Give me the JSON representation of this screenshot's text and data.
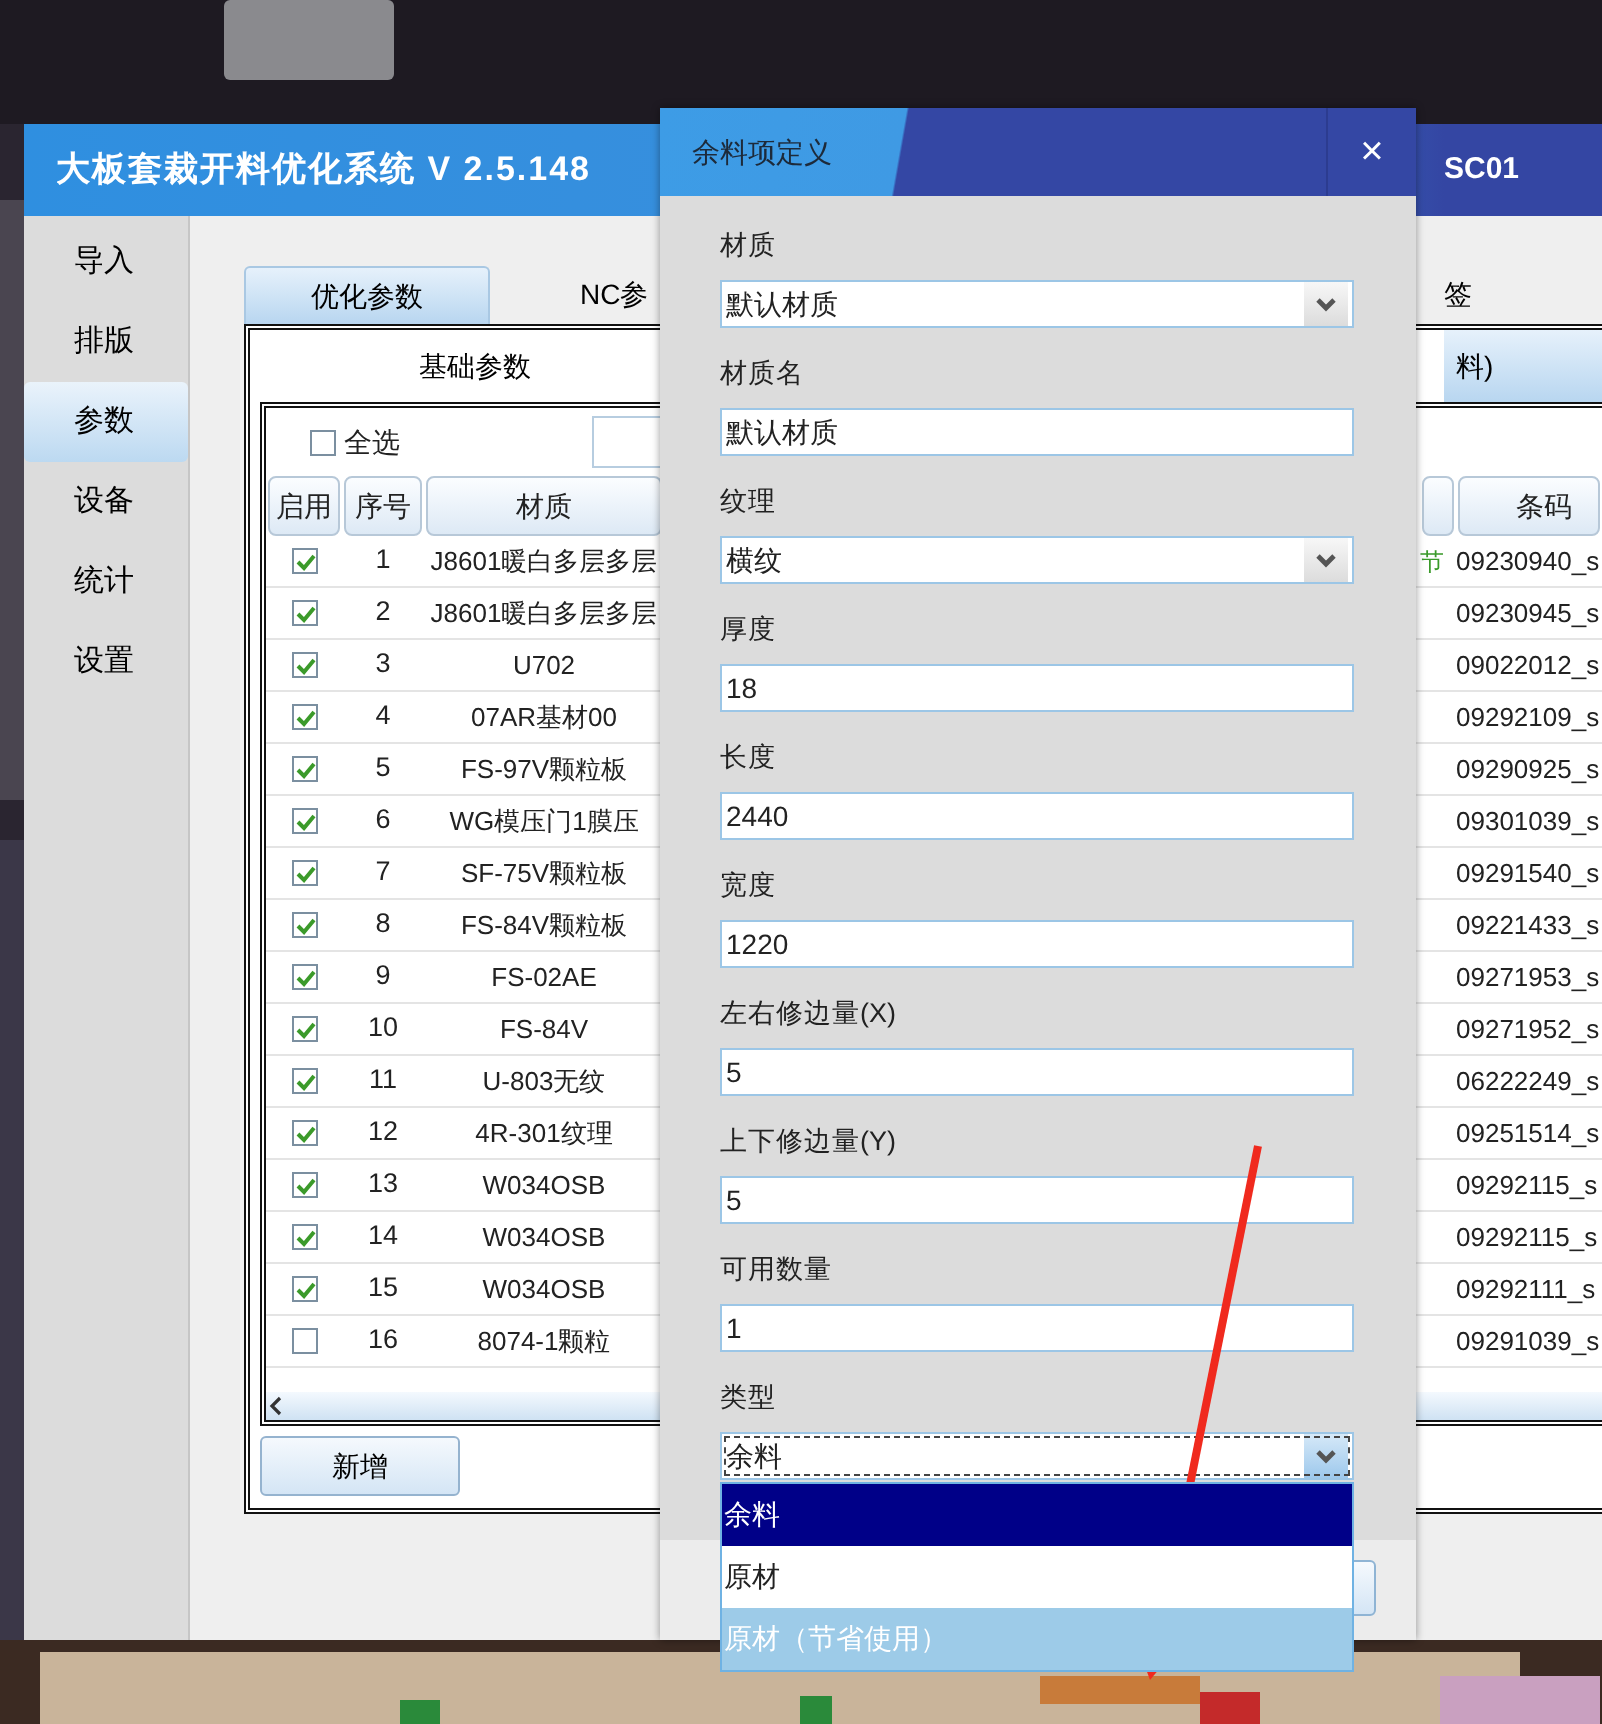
{
  "main_window": {
    "title": "大板套裁开料优化系统 V 2.5.148",
    "badge": "SC01"
  },
  "sidebar": {
    "items": [
      {
        "label": "导入",
        "selected": false
      },
      {
        "label": "排版",
        "selected": false
      },
      {
        "label": "参数",
        "selected": true
      },
      {
        "label": "设备",
        "selected": false
      },
      {
        "label": "统计",
        "selected": false
      },
      {
        "label": "设置",
        "selected": false
      }
    ]
  },
  "tabs": [
    {
      "label": "优化参数",
      "selected": true
    },
    {
      "label": "NC参",
      "selected": false
    },
    {
      "label": "签",
      "selected": false
    }
  ],
  "subtabs": [
    {
      "label": "基础参数",
      "selected": false
    },
    {
      "label": "料)",
      "selected": true
    }
  ],
  "select_all": {
    "label": "全选",
    "checked": false
  },
  "table": {
    "columns": [
      {
        "label": "启用"
      },
      {
        "label": "序号"
      },
      {
        "label": "材质"
      },
      {
        "label": "条码"
      }
    ],
    "rows": [
      {
        "enabled": true,
        "number": "1",
        "material": "J8601暖白多层多层",
        "column_4": "节",
        "barcode": "09230940_s"
      },
      {
        "enabled": true,
        "number": "2",
        "material": "J8601暖白多层多层",
        "barcode": "09230945_s"
      },
      {
        "enabled": true,
        "number": "3",
        "material": "U702",
        "barcode": "09022012_s"
      },
      {
        "enabled": true,
        "number": "4",
        "material": "07AR基材00",
        "barcode": "09292109_s"
      },
      {
        "enabled": true,
        "number": "5",
        "material": "FS-97V颗粒板",
        "barcode": "09290925_s"
      },
      {
        "enabled": true,
        "number": "6",
        "material": "WG模压门1膜压",
        "barcode": "09301039_s"
      },
      {
        "enabled": true,
        "number": "7",
        "material": "SF-75V颗粒板",
        "barcode": "09291540_s"
      },
      {
        "enabled": true,
        "number": "8",
        "material": "FS-84V颗粒板",
        "barcode": "09221433_s"
      },
      {
        "enabled": true,
        "number": "9",
        "material": "FS-02AE",
        "barcode": "09271953_s"
      },
      {
        "enabled": true,
        "number": "10",
        "material": "FS-84V",
        "barcode": "09271952_s"
      },
      {
        "enabled": true,
        "number": "11",
        "material": "U-803无纹",
        "barcode": "06222249_s"
      },
      {
        "enabled": true,
        "number": "12",
        "material": "4R-301纹理",
        "barcode": "09251514_s"
      },
      {
        "enabled": true,
        "number": "13",
        "material": "W034OSB",
        "barcode": "09292115_s"
      },
      {
        "enabled": true,
        "number": "14",
        "material": "W034OSB",
        "barcode": "09292115_s"
      },
      {
        "enabled": true,
        "number": "15",
        "material": "W034OSB",
        "barcode": "09292111_s"
      },
      {
        "enabled": false,
        "number": "16",
        "material": "8074-1颗粒",
        "barcode": "09291039_s"
      }
    ]
  },
  "add_button": "新增",
  "dialog": {
    "title": "余料项定义",
    "close": "×",
    "fields": [
      {
        "label": "材质",
        "kind": "select",
        "value": "默认材质"
      },
      {
        "label": "材质名",
        "kind": "text",
        "value": "默认材质"
      },
      {
        "label": "纹理",
        "kind": "select",
        "value": "横纹"
      },
      {
        "label": "厚度",
        "kind": "text",
        "value": "18"
      },
      {
        "label": "长度",
        "kind": "text",
        "value": "2440"
      },
      {
        "label": "宽度",
        "kind": "text",
        "value": "1220"
      },
      {
        "label": "左右修边量(X)",
        "kind": "text",
        "value": "5"
      },
      {
        "label": "上下修边量(Y)",
        "kind": "text",
        "value": "5"
      },
      {
        "label": "可用数量",
        "kind": "text",
        "value": "1"
      },
      {
        "label": "类型",
        "kind": "select",
        "value": "余料",
        "expanded": true,
        "options": [
          {
            "label": "余料",
            "selected": true,
            "highlighted": false
          },
          {
            "label": "原材",
            "selected": false,
            "highlighted": false
          },
          {
            "label": "原材（节省使用）",
            "selected": false,
            "highlighted": true
          }
        ]
      }
    ]
  }
}
